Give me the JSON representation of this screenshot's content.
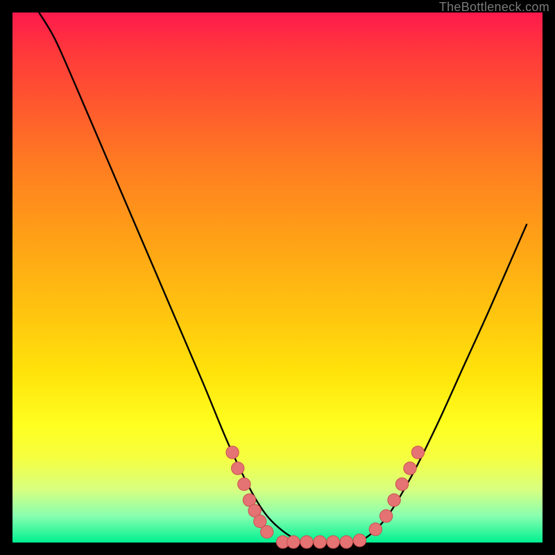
{
  "watermark": "TheBottleneck.com",
  "colors": {
    "page_bg": "#000000",
    "curve_stroke": "#000000",
    "bead_fill": "#e57373",
    "bead_stroke": "#c94f4f",
    "gradient_stops": [
      "#ff1a4d",
      "#ff3a3a",
      "#ff5a2e",
      "#ff7a22",
      "#ff9a18",
      "#ffc010",
      "#ffe30a",
      "#ffff20",
      "#f6ff40",
      "#d8ff80",
      "#88ffb0",
      "#00f090"
    ]
  },
  "chart_data": {
    "type": "line",
    "title": "",
    "xlabel": "",
    "ylabel": "",
    "xlim": [
      0,
      100
    ],
    "ylim": [
      0,
      100
    ],
    "grid": false,
    "legend": false,
    "series": [
      {
        "name": "bottleneck-curve",
        "x": [
          5,
          8,
          12,
          18,
          24,
          30,
          36,
          41,
          46,
          50,
          55,
          60,
          65,
          70,
          75,
          80,
          85,
          90,
          97
        ],
        "y": [
          100,
          95,
          86,
          72,
          58,
          44,
          30,
          18,
          8,
          3,
          0,
          0,
          0,
          4,
          12,
          22,
          33,
          44,
          60
        ]
      }
    ],
    "markers": [
      {
        "name": "beads-left-branch",
        "points": [
          {
            "x": 41.5,
            "y": 17
          },
          {
            "x": 42.5,
            "y": 14
          },
          {
            "x": 43.7,
            "y": 11
          },
          {
            "x": 44.7,
            "y": 8
          },
          {
            "x": 45.7,
            "y": 6
          },
          {
            "x": 46.7,
            "y": 4
          },
          {
            "x": 48.0,
            "y": 2
          }
        ]
      },
      {
        "name": "beads-flat-bottom",
        "points": [
          {
            "x": 51,
            "y": 0.1
          },
          {
            "x": 53,
            "y": 0.1
          },
          {
            "x": 55.5,
            "y": 0.1
          },
          {
            "x": 58,
            "y": 0.1
          },
          {
            "x": 60.5,
            "y": 0.1
          },
          {
            "x": 63,
            "y": 0.1
          },
          {
            "x": 65.5,
            "y": 0.4
          }
        ]
      },
      {
        "name": "beads-right-branch",
        "points": [
          {
            "x": 68.5,
            "y": 2.5
          },
          {
            "x": 70.5,
            "y": 5
          },
          {
            "x": 72.0,
            "y": 8
          },
          {
            "x": 73.5,
            "y": 11
          },
          {
            "x": 75.0,
            "y": 14
          },
          {
            "x": 76.5,
            "y": 17
          }
        ]
      }
    ]
  }
}
